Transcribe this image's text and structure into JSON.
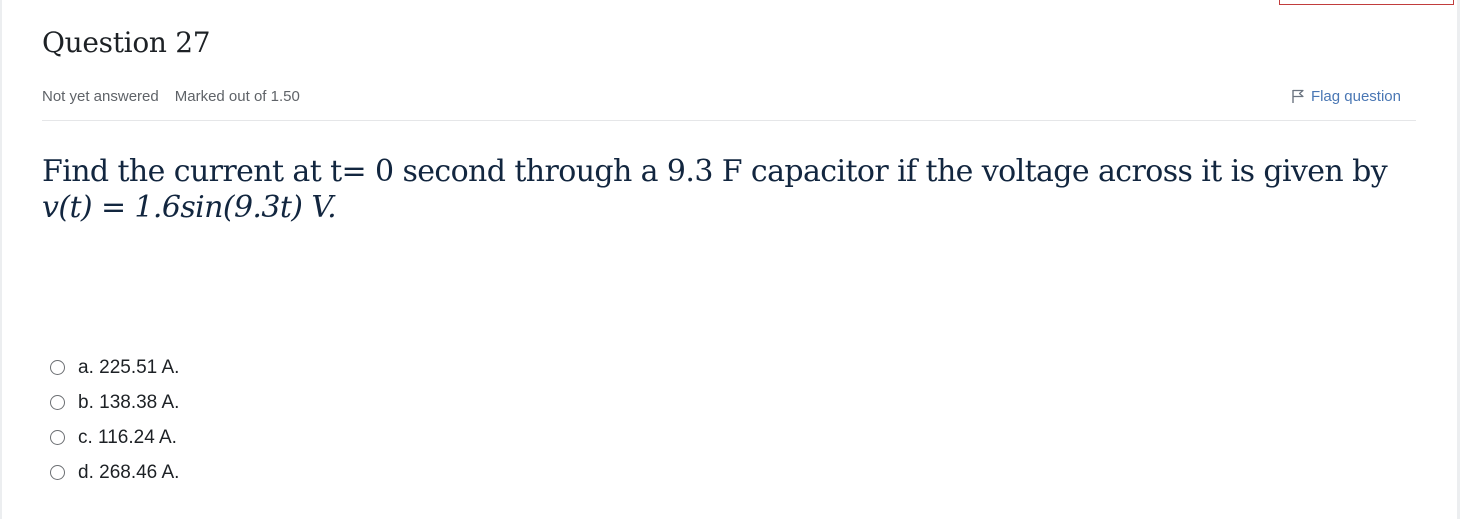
{
  "question": {
    "title": "Question 27",
    "status": "Not yet answered",
    "marks": "Marked out of 1.50",
    "flag_label": "Flag question",
    "text": "Find the current at t= 0 second through a 9.3 F capacitor if the voltage across it is given by",
    "equation": "v(t) = 1.6sin(9.3t) V."
  },
  "answers": [
    {
      "label": "a. 225.51 A.",
      "selected": false
    },
    {
      "label": "b. 138.38 A.",
      "selected": false
    },
    {
      "label": "c. 116.24 A.",
      "selected": false
    },
    {
      "label": "d. 268.46 A.",
      "selected": false
    }
  ],
  "icons": {
    "flag": "flag-outline-icon",
    "radio": "radio-unchecked-icon"
  },
  "colors": {
    "link": "#4a77b4",
    "title_text": "#1d2125",
    "question_text": "#12263f",
    "muted_text": "#5f6368",
    "corner_box_border": "#c13d3d"
  }
}
